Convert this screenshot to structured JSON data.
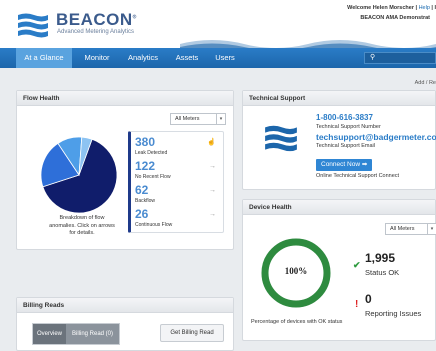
{
  "header": {
    "brand": "BEACON",
    "brand_mark": "®",
    "subtitle": "Advanced Metering Analytics",
    "welcome_prefix": "Welcome Helen Morscher | ",
    "help": "Help",
    "welcome_tail": " | I",
    "account": "BEACON AMA Demonstrat"
  },
  "nav": {
    "items": [
      {
        "label": "At a Glance",
        "active": true
      },
      {
        "label": "Monitor"
      },
      {
        "label": "Analytics"
      },
      {
        "label": "Assets"
      },
      {
        "label": "Users"
      }
    ],
    "search_icon": "search-icon"
  },
  "subbar": {
    "text": "Add / Re"
  },
  "flow_health": {
    "title": "Flow Health",
    "filter": "All Meters",
    "caption": "Breakdown of flow anomalies. Click on arrows for details.",
    "stats": [
      {
        "value": "380",
        "label": "Leak Detected"
      },
      {
        "value": "122",
        "label": "No Recent Flow"
      },
      {
        "value": "62",
        "label": "Backflow"
      },
      {
        "value": "26",
        "label": "Continuous Flow"
      }
    ],
    "pie": {
      "type": "pie",
      "slices": [
        {
          "name": "Leak Detected",
          "value": 380,
          "color": "#101d6b"
        },
        {
          "name": "No Recent Flow",
          "value": 122,
          "color": "#2e6fd9"
        },
        {
          "name": "Backflow",
          "value": 62,
          "color": "#4e9ee8"
        },
        {
          "name": "Continuous Flow",
          "value": 26,
          "color": "#8dc3f2"
        }
      ]
    }
  },
  "tech_support": {
    "title": "Technical Support",
    "phone": "1-800-616-3837",
    "phone_label": "Technical Support Number",
    "email": "techsupport@badgermeter.com",
    "email_label": "Technical Support Email",
    "connect_button": "Connect Now ➡",
    "connect_label": "Online Technical Support Connect"
  },
  "device_health": {
    "title": "Device Health",
    "filter": "All Meters",
    "percent_label": "100%",
    "percent_value": 1.0,
    "caption": "Percentage of devices with OK status",
    "status_ok_count": "1,995",
    "status_ok_label": "Status OK",
    "issues_count": "0",
    "issues_label": "Reporting Issues",
    "ring_color": "#2e8b3f"
  },
  "billing_reads": {
    "title": "Billing Reads",
    "overview_label": "Overview",
    "billing_read_label": "Billing Read (0)",
    "get_button": "Get Billing Read"
  },
  "colors": {
    "nav_blue": "#1c66ab",
    "accent": "#2a7cc7"
  }
}
